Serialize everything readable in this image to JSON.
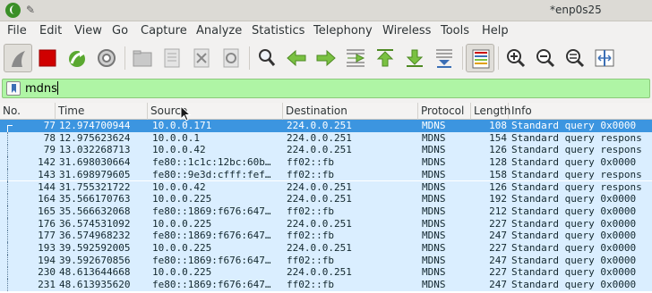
{
  "window": {
    "title": "*enp0s25"
  },
  "menu": [
    "File",
    "Edit",
    "View",
    "Go",
    "Capture",
    "Analyze",
    "Statistics",
    "Telephony",
    "Wireless",
    "Tools",
    "Help"
  ],
  "filter": {
    "value": "mdns"
  },
  "columns": [
    "No.",
    "Time",
    "Source",
    "Destination",
    "Protocol",
    "Length",
    "Info"
  ],
  "packets": [
    {
      "no": "77",
      "time": "12.974700944",
      "src": "10.0.0.171",
      "dst": "224.0.0.251",
      "proto": "MDNS",
      "len": "108",
      "info": "Standard query 0x0000",
      "selected": true
    },
    {
      "no": "78",
      "time": "12.975623624",
      "src": "10.0.0.1",
      "dst": "224.0.0.251",
      "proto": "MDNS",
      "len": "154",
      "info": "Standard query respons"
    },
    {
      "no": "79",
      "time": "13.032268713",
      "src": "10.0.0.42",
      "dst": "224.0.0.251",
      "proto": "MDNS",
      "len": "126",
      "info": "Standard query respons"
    },
    {
      "no": "142",
      "time": "31.698030664",
      "src": "fe80::1c1c:12bc:60b…",
      "dst": "ff02::fb",
      "proto": "MDNS",
      "len": "128",
      "info": "Standard query 0x0000"
    },
    {
      "no": "143",
      "time": "31.698979605",
      "src": "fe80::9e3d:cfff:fef…",
      "dst": "ff02::fb",
      "proto": "MDNS",
      "len": "158",
      "info": "Standard query respons"
    },
    {
      "no": "144",
      "time": "31.755321722",
      "src": "10.0.0.42",
      "dst": "224.0.0.251",
      "proto": "MDNS",
      "len": "126",
      "info": "Standard query respons"
    },
    {
      "no": "164",
      "time": "35.566170763",
      "src": "10.0.0.225",
      "dst": "224.0.0.251",
      "proto": "MDNS",
      "len": "192",
      "info": "Standard query 0x0000"
    },
    {
      "no": "165",
      "time": "35.566632068",
      "src": "fe80::1869:f676:647…",
      "dst": "ff02::fb",
      "proto": "MDNS",
      "len": "212",
      "info": "Standard query 0x0000"
    },
    {
      "no": "176",
      "time": "36.574531092",
      "src": "10.0.0.225",
      "dst": "224.0.0.251",
      "proto": "MDNS",
      "len": "227",
      "info": "Standard query 0x0000"
    },
    {
      "no": "177",
      "time": "36.574968232",
      "src": "fe80::1869:f676:647…",
      "dst": "ff02::fb",
      "proto": "MDNS",
      "len": "247",
      "info": "Standard query 0x0000"
    },
    {
      "no": "193",
      "time": "39.592592005",
      "src": "10.0.0.225",
      "dst": "224.0.0.251",
      "proto": "MDNS",
      "len": "227",
      "info": "Standard query 0x0000"
    },
    {
      "no": "194",
      "time": "39.592670856",
      "src": "fe80::1869:f676:647…",
      "dst": "ff02::fb",
      "proto": "MDNS",
      "len": "247",
      "info": "Standard query 0x0000"
    },
    {
      "no": "230",
      "time": "48.613644668",
      "src": "10.0.0.225",
      "dst": "224.0.0.251",
      "proto": "MDNS",
      "len": "227",
      "info": "Standard query 0x0000"
    },
    {
      "no": "231",
      "time": "48.613935620",
      "src": "fe80::1869:f676:647…",
      "dst": "ff02::fb",
      "proto": "MDNS",
      "len": "247",
      "info": "Standard query 0x0000"
    }
  ],
  "icons": [
    "shark-fin-start-icon",
    "stop-capture-icon",
    "restart-capture-icon",
    "capture-options-icon",
    "open-file-icon",
    "save-file-icon",
    "close-file-icon",
    "reload-file-icon",
    "find-packet-icon",
    "go-back-icon",
    "go-forward-icon",
    "go-to-packet-icon",
    "go-first-icon",
    "go-last-icon",
    "autoscroll-icon",
    "colorize-icon",
    "zoom-in-icon",
    "zoom-out-icon",
    "normal-size-icon",
    "resize-columns-icon"
  ]
}
